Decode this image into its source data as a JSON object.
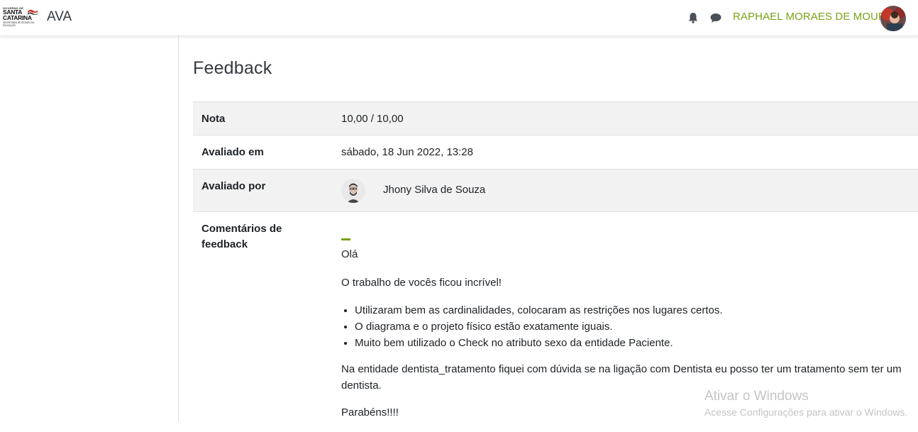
{
  "navbar": {
    "logo": {
      "line1": "GOVERNO DE",
      "line2": "SANTA",
      "line3": "CATARINA",
      "line4": "SECRETARIA DE ESTADO DA EDUCAÇÃO"
    },
    "brand": "AVA",
    "icons": [
      "bell-icon",
      "chat-icon"
    ],
    "user_name": "RAPHAEL MORAES DE MOURA",
    "user_name_color": "#7aa116"
  },
  "page": {
    "title": "Feedback"
  },
  "feedback_table": {
    "rows": [
      {
        "label": "Nota",
        "value": "10,00 / 10,00"
      },
      {
        "label": "Avaliado em",
        "value": "sábado, 18 Jun 2022, 13:28"
      },
      {
        "label": "Avaliado por",
        "value": "Jhony Silva de Souza"
      },
      {
        "label": "Comentários de feedback"
      }
    ],
    "comments": {
      "greeting": "Olá",
      "paragraph1": "O trabalho de vocês ficou incrível!",
      "bullets": [
        "Utilizaram bem as cardinalidades, colocaram as restrições nos lugares certos.",
        "O diagrama e o projeto físico estão exatamente iguais.",
        "Muito bem utilizado o Check no atributo sexo da entidade Paciente."
      ],
      "paragraph2_line1": "Na entidade dentista_tratamento fiquei com dúvida se na ligação com Dentista eu posso ter um tratamento sem ter um",
      "paragraph2_line2": "dentista.",
      "closing": "Parabéns!!!!"
    }
  },
  "watermark": {
    "title": "Ativar o Windows",
    "subtitle": "Acesse Configurações para ativar o Windows."
  },
  "colors": {
    "accent": "#7aa116",
    "row_shade": "#f2f2f2"
  }
}
